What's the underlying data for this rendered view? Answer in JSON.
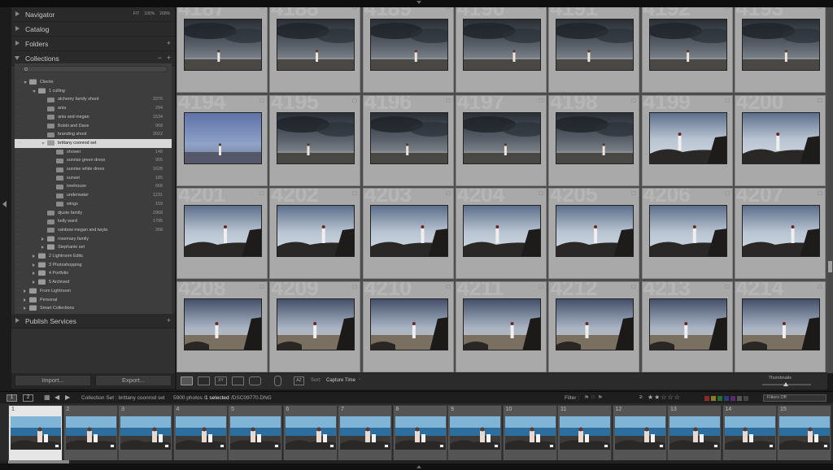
{
  "panel": {
    "navigator": {
      "label": "Navigator",
      "options": [
        "FIT",
        "100%",
        "200%"
      ]
    },
    "catalog": {
      "label": "Catalog"
    },
    "folders": {
      "label": "Folders"
    },
    "collections": {
      "label": "Collections"
    },
    "publish": {
      "label": "Publish Services"
    },
    "import_label": "Import...",
    "export_label": "Export..."
  },
  "collections": [
    {
      "depth": 0,
      "name": "Clients",
      "count": "",
      "kind": "set",
      "state": "open"
    },
    {
      "depth": 1,
      "name": "1 culling",
      "count": "",
      "kind": "set",
      "state": "open"
    },
    {
      "depth": 2,
      "name": "alchemy family shoot",
      "count": "3376",
      "kind": "col",
      "state": ""
    },
    {
      "depth": 2,
      "name": "ania",
      "count": "294",
      "kind": "col",
      "state": ""
    },
    {
      "depth": 2,
      "name": "ania and megan",
      "count": "1534",
      "kind": "col",
      "state": ""
    },
    {
      "depth": 2,
      "name": "Bobbi and Dave",
      "count": "968",
      "kind": "col",
      "state": ""
    },
    {
      "depth": 2,
      "name": "branding shoot",
      "count": "3022",
      "kind": "col",
      "state": ""
    },
    {
      "depth": 2,
      "name": "brittany coonrod set",
      "count": "",
      "kind": "set",
      "state": "open",
      "selected": true
    },
    {
      "depth": 3,
      "name": "shower",
      "count": "148",
      "kind": "col",
      "state": ""
    },
    {
      "depth": 3,
      "name": "sunrise green dress",
      "count": "955",
      "kind": "col",
      "state": ""
    },
    {
      "depth": 3,
      "name": "sunrise white dress",
      "count": "1628",
      "kind": "col",
      "state": ""
    },
    {
      "depth": 3,
      "name": "sunset",
      "count": "185",
      "kind": "col",
      "state": ""
    },
    {
      "depth": 3,
      "name": "treehouse",
      "count": "668",
      "kind": "col",
      "state": ""
    },
    {
      "depth": 3,
      "name": "underwater",
      "count": "1231",
      "kind": "col",
      "state": ""
    },
    {
      "depth": 3,
      "name": "wings",
      "count": "159",
      "kind": "col",
      "state": ""
    },
    {
      "depth": 2,
      "name": "djuste family",
      "count": "2968",
      "kind": "col",
      "state": ""
    },
    {
      "depth": 2,
      "name": "kelly ward",
      "count": "1795",
      "kind": "col",
      "state": ""
    },
    {
      "depth": 2,
      "name": "rainbow megan and twyla",
      "count": "268",
      "kind": "col",
      "state": ""
    },
    {
      "depth": 2,
      "name": "rosemary family",
      "count": "",
      "kind": "set",
      "state": "closed"
    },
    {
      "depth": 2,
      "name": "Stephanie set",
      "count": "",
      "kind": "set",
      "state": "closed"
    },
    {
      "depth": 1,
      "name": "2 Lightroom Edits",
      "count": "",
      "kind": "set",
      "state": "closed"
    },
    {
      "depth": 1,
      "name": "3 Photoshopping",
      "count": "",
      "kind": "set",
      "state": "closed"
    },
    {
      "depth": 1,
      "name": "4 Portfolio",
      "count": "",
      "kind": "set",
      "state": "closed"
    },
    {
      "depth": 1,
      "name": "5 Archived",
      "count": "",
      "kind": "set",
      "state": "closed"
    },
    {
      "depth": 0,
      "name": "From Lightroom",
      "count": "",
      "kind": "set",
      "state": "closed"
    },
    {
      "depth": 0,
      "name": "Personal",
      "count": "",
      "kind": "set",
      "state": "closed"
    },
    {
      "depth": 0,
      "name": "Smart Collections",
      "count": "",
      "kind": "set",
      "state": "closed"
    }
  ],
  "grid": {
    "cells": [
      {
        "num": "4187",
        "scene": "storm"
      },
      {
        "num": "4188",
        "scene": "storm"
      },
      {
        "num": "4189",
        "scene": "storm"
      },
      {
        "num": "4190",
        "scene": "storm"
      },
      {
        "num": "4191",
        "scene": "storm"
      },
      {
        "num": "4192",
        "scene": "storm"
      },
      {
        "num": "4193",
        "scene": "storm"
      },
      {
        "num": "4194",
        "scene": "blue"
      },
      {
        "num": "4195",
        "scene": "storm"
      },
      {
        "num": "4196",
        "scene": "storm"
      },
      {
        "num": "4197",
        "scene": "storm"
      },
      {
        "num": "4198",
        "scene": "storm"
      },
      {
        "num": "4199",
        "scene": "rocks"
      },
      {
        "num": "4200",
        "scene": "rocks"
      },
      {
        "num": "4201",
        "scene": "rocks"
      },
      {
        "num": "4202",
        "scene": "rocks"
      },
      {
        "num": "4203",
        "scene": "rocks"
      },
      {
        "num": "4204",
        "scene": "rocks"
      },
      {
        "num": "4205",
        "scene": "rocks"
      },
      {
        "num": "4206",
        "scene": "rocks"
      },
      {
        "num": "4207",
        "scene": "rocks"
      },
      {
        "num": "4208",
        "scene": "beach"
      },
      {
        "num": "4209",
        "scene": "beach"
      },
      {
        "num": "4210",
        "scene": "beach"
      },
      {
        "num": "4211",
        "scene": "beach"
      },
      {
        "num": "4212",
        "scene": "beach"
      },
      {
        "num": "4213",
        "scene": "beach"
      },
      {
        "num": "4214",
        "scene": "beach"
      }
    ]
  },
  "toolbar": {
    "sort_label": "Sort:",
    "sort_value": "Capture Time",
    "thumbnails_label": "Thumbnails"
  },
  "filmstrip_bar": {
    "page1": "1",
    "page2": "2",
    "source": "Collection Set : brittany coonrod set",
    "photos": "5900 photos /",
    "selected": "1 selected",
    "file": "/DSC09770.DNG",
    "filter_label": "Filter :",
    "rating_op": "≥",
    "stars": "★★☆☆☆",
    "filters_off": "Filters Off"
  },
  "filmstrip": {
    "cells": [
      {
        "num": "1"
      },
      {
        "num": "2"
      },
      {
        "num": "3"
      },
      {
        "num": "4"
      },
      {
        "num": "5"
      },
      {
        "num": "6"
      },
      {
        "num": "7"
      },
      {
        "num": "8"
      },
      {
        "num": "9"
      },
      {
        "num": "10"
      },
      {
        "num": "11"
      },
      {
        "num": "12"
      },
      {
        "num": "13"
      },
      {
        "num": "14"
      },
      {
        "num": "15"
      }
    ]
  },
  "colors": {
    "accent_select": "#d8d8d8",
    "grid_bg": "#4c4c4c",
    "cell_bg": "#a9a9a9",
    "label_red": "#8a2a2a",
    "label_yellow": "#8a7a2a",
    "label_green": "#2a6a2a",
    "label_blue": "#2a3a7a",
    "label_purple": "#5a2a6a"
  }
}
